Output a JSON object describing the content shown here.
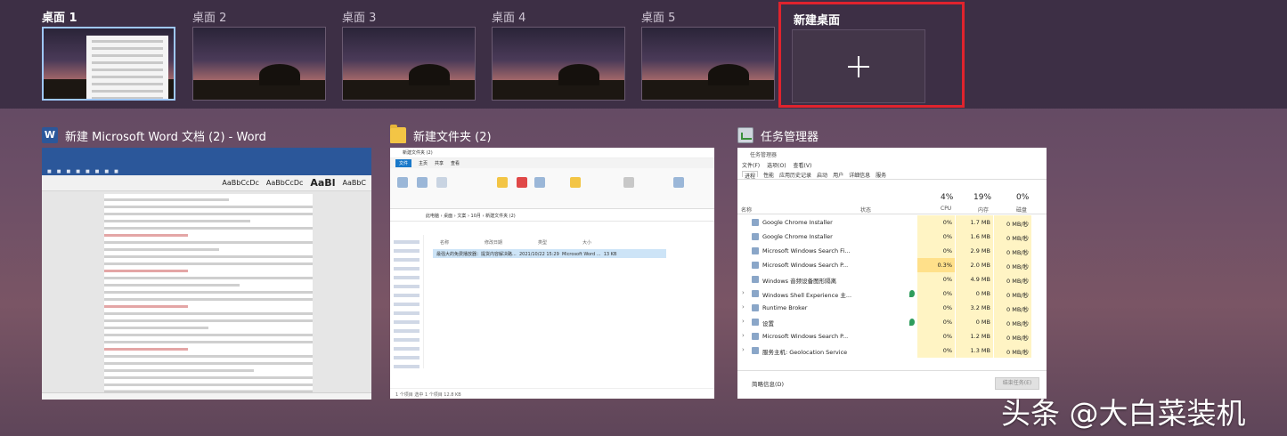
{
  "desktops": [
    {
      "label": "桌面 1",
      "active": true
    },
    {
      "label": "桌面 2",
      "active": false
    },
    {
      "label": "桌面 3",
      "active": false
    },
    {
      "label": "桌面 4",
      "active": false
    },
    {
      "label": "桌面 5",
      "active": false
    }
  ],
  "new_desktop": {
    "label": "新建桌面",
    "icon": "plus-icon"
  },
  "windows": {
    "word": {
      "title": "新建 Microsoft Word 文档 (2) - Word",
      "icon": "word-icon"
    },
    "explorer": {
      "title": "新建文件夹 (2)",
      "icon": "folder-icon",
      "inner_title": "新建文件夹 (2)",
      "tabs": [
        "文件",
        "主页",
        "共享",
        "查看"
      ],
      "address": "此电脑 › 桌面 › 文案 › 10月 › 新建文件夹 (2)",
      "columns": [
        "名称",
        "修改日期",
        "类型",
        "大小"
      ],
      "file": {
        "name": "最强大的免费播放器：提货内容解决路...",
        "date": "2021/10/22 15:29",
        "type": "Microsoft Word ...",
        "size": "13 KB"
      },
      "status": "1 个项目   选中 1 个项目  12.8 KB"
    },
    "taskmgr": {
      "title": "任务管理器",
      "icon": "task-manager-icon",
      "inner_title": "任务管理器",
      "menu": [
        "文件(F)",
        "选项(O)",
        "查看(V)"
      ],
      "tabs": [
        "进程",
        "性能",
        "应用历史记录",
        "启动",
        "用户",
        "详细信息",
        "服务"
      ],
      "columns": {
        "name": "名称",
        "status": "状态",
        "cpu_pct": "4%",
        "cpu": "CPU",
        "mem_pct": "19%",
        "mem": "内存",
        "disk_pct": "0%",
        "disk": "磁盘"
      },
      "rows": [
        {
          "name": "Google Chrome Installer",
          "cpu": "0%",
          "mem": "1.7 MB",
          "disk": "0 MB/秒"
        },
        {
          "name": "Google Chrome Installer",
          "cpu": "0%",
          "mem": "1.6 MB",
          "disk": "0 MB/秒"
        },
        {
          "name": "Microsoft Windows Search Fi...",
          "cpu": "0%",
          "mem": "2.9 MB",
          "disk": "0 MB/秒"
        },
        {
          "name": "Microsoft Windows Search P...",
          "cpu": "0.3%",
          "mem": "2.0 MB",
          "disk": "0 MB/秒"
        },
        {
          "name": "Windows 音频设备图形隔离",
          "cpu": "0%",
          "mem": "4.9 MB",
          "disk": "0 MB/秒"
        },
        {
          "name": "Windows Shell Experience 主...",
          "cpu": "0%",
          "mem": "0 MB",
          "disk": "0 MB/秒"
        },
        {
          "name": "Runtime Broker",
          "cpu": "0%",
          "mem": "3.2 MB",
          "disk": "0 MB/秒"
        },
        {
          "name": "设置",
          "cpu": "0%",
          "mem": "0 MB",
          "disk": "0 MB/秒"
        },
        {
          "name": "Microsoft Windows Search P...",
          "cpu": "0%",
          "mem": "1.2 MB",
          "disk": "0 MB/秒"
        },
        {
          "name": "服务主机: Geolocation Service",
          "cpu": "0%",
          "mem": "1.3 MB",
          "disk": "0 MB/秒"
        }
      ],
      "fewer_details": "简略信息(D)",
      "end_task": "结束任务(E)"
    }
  },
  "watermark": "头条 @大白菜装机"
}
